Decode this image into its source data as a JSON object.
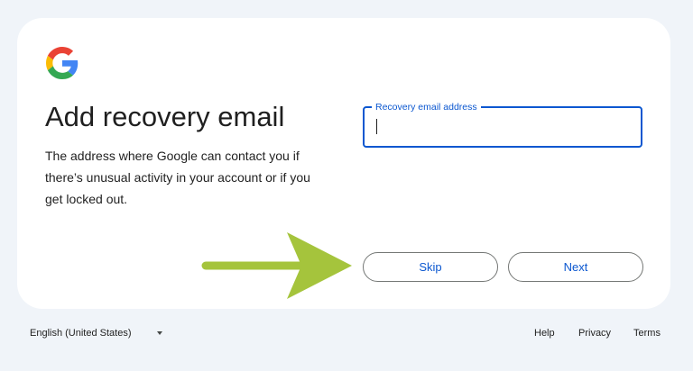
{
  "card": {
    "title": "Add recovery email",
    "description": "The address where Google can contact you if there’s unusual activity in your account or if you get locked out."
  },
  "email_field": {
    "label": "Recovery email address",
    "value": ""
  },
  "buttons": {
    "skip_label": "Skip",
    "next_label": "Next"
  },
  "footer": {
    "language": "English (United States)",
    "links": [
      "Help",
      "Privacy",
      "Terms"
    ]
  },
  "colors": {
    "background": "#f0f4f9",
    "accent": "#0b57d0",
    "arrow": "#a5c43c"
  },
  "icons": {
    "logo": "google-g-logo",
    "language_dropdown": "caret-down-icon",
    "annotation": "arrow-right-icon"
  }
}
